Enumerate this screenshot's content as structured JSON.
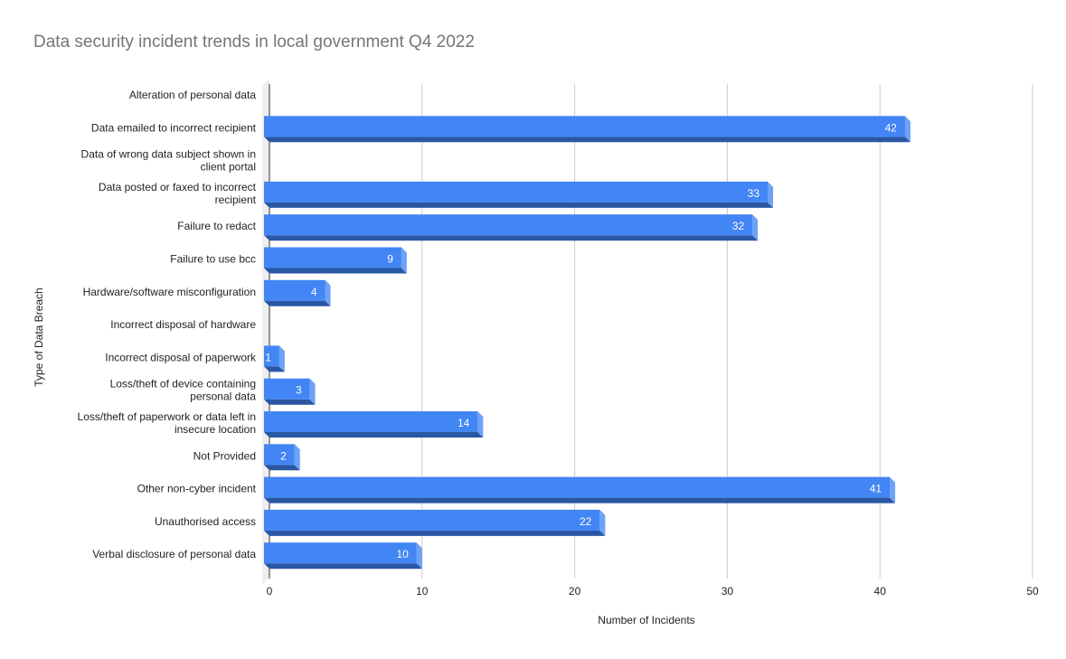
{
  "chart_data": {
    "type": "bar",
    "orientation": "horizontal",
    "title": "Data security incident trends in local government Q4 2022",
    "xlabel": "Number of Incidents",
    "ylabel": "Type of Data Breach",
    "xlim": [
      0,
      50
    ],
    "xticks": [
      0,
      10,
      20,
      30,
      40,
      50
    ],
    "grid": true,
    "legend": "none",
    "colors": {
      "bar": "#4285f4",
      "bar_shadow": "#2a56a3",
      "bar_side": "#6ea2f7",
      "grid": "#cccccc",
      "axis": "#333333",
      "floor": "#eeeeee"
    },
    "categories": [
      "Alteration of personal data",
      "Data emailed to incorrect recipient",
      "Data of wrong data subject shown in client portal",
      "Data posted or faxed to incorrect recipient",
      "Failure to redact",
      "Failure to use bcc",
      "Hardware/software misconfiguration",
      "Incorrect disposal of hardware",
      "Incorrect disposal of paperwork",
      "Loss/theft of device containing personal data",
      "Loss/theft of paperwork or data left in insecure location",
      "Not Provided",
      "Other non-cyber incident",
      "Unauthorised access",
      "Verbal disclosure of personal data"
    ],
    "category_lines": [
      [
        "Alteration of personal data"
      ],
      [
        "Data emailed to incorrect recipient"
      ],
      [
        "Data of wrong data subject shown in",
        "client portal"
      ],
      [
        "Data posted or faxed to incorrect",
        "recipient"
      ],
      [
        "Failure to redact"
      ],
      [
        "Failure to use bcc"
      ],
      [
        "Hardware/software misconfiguration"
      ],
      [
        "Incorrect disposal of hardware"
      ],
      [
        "Incorrect disposal of paperwork"
      ],
      [
        "Loss/theft of device containing",
        "personal data"
      ],
      [
        "Loss/theft of paperwork or data left in",
        "insecure location"
      ],
      [
        "Not Provided"
      ],
      [
        "Other non-cyber incident"
      ],
      [
        "Unauthorised access"
      ],
      [
        "Verbal disclosure of personal data"
      ]
    ],
    "values": [
      0,
      42,
      0,
      33,
      32,
      9,
      4,
      0,
      1,
      3,
      14,
      2,
      41,
      22,
      10
    ]
  }
}
